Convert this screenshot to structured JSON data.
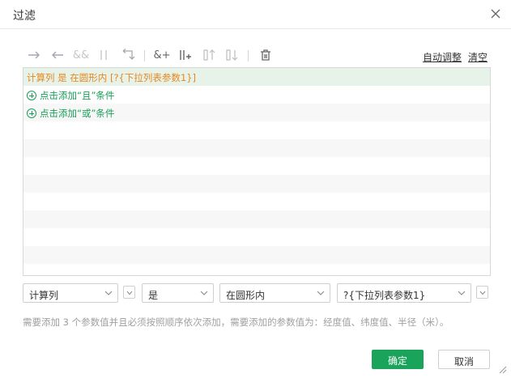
{
  "dialog": {
    "title": "过滤",
    "close_icon": "close-icon"
  },
  "toolbar": {
    "icons": [
      "arrow-right-icon",
      "arrow-left-icon",
      "and-icon",
      "or-icon",
      "return-arrow-icon",
      "add-and-icon",
      "add-or-icon",
      "move-up-icon",
      "move-down-icon",
      "trash-icon"
    ],
    "auto_adjust": "自动调整",
    "clear": "清空"
  },
  "conditions": {
    "selected_condition": "计算列 是 在圆形内 [?{下拉列表参数1}]",
    "add_and": "点击添加“且”条件",
    "add_or": "点击添加“或”条件"
  },
  "editor": {
    "field_value": "计算列",
    "operator_value": "是",
    "relation_value": "在圆形内",
    "param_value": "?{下拉列表参数1}"
  },
  "hint": "需要添加 3 个参数值并且必须按照顺序依次添加，需要添加的参数值为：经度值、纬度值、半径（米）。",
  "footer": {
    "ok": "确定",
    "cancel": "取消"
  },
  "colors": {
    "accent_green": "#1aa35a",
    "condition_orange": "#e8871e",
    "selected_row": "#e7f3e9"
  }
}
